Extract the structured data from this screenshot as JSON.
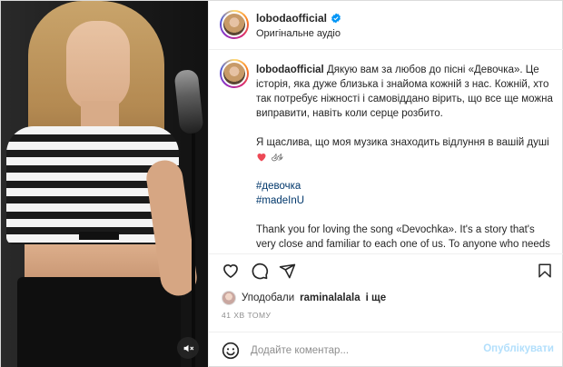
{
  "header": {
    "username": "lobodaofficial",
    "audio": "Оригінальне аудіо"
  },
  "caption": {
    "username": "lobodaofficial",
    "paragraph1": "Дякую вам за любов до пісні «Девочка». Це історія, яка дуже близька і знайома кожній з нас. Кожній, хто так потребує ніжності і самовіддано вірить, що все ще можна виправити, навіть коли серце розбито.",
    "paragraph2": "Я щаслива, що моя музика знаходить відлуння в вашій душі",
    "hashtags": [
      "#девочка",
      "#madeInU"
    ],
    "paragraph3": "Thank you for loving the song «Devochka». It's a story that's very close and familiar to each one of us. To anyone who needs tenderness and still believes that everything can be fixed, even when their heart is broken."
  },
  "likes": {
    "prefix": "Уподобали",
    "user": "raminalalala",
    "suffix": "і ще"
  },
  "time": "41 ХВ ТОМУ",
  "comment": {
    "placeholder": "Додайте коментар...",
    "publish": "Опублікувати"
  },
  "colors": {
    "verified": "#0095f6",
    "link": "#00376b",
    "publish_disabled": "#b2dffc",
    "heart": "#ed4956"
  },
  "icons": [
    "heart-icon",
    "comment-icon",
    "share-icon",
    "bookmark-icon",
    "emoji-icon",
    "sound-off-icon",
    "verified-icon",
    "red-heart-emoji",
    "white-doves-emoji"
  ]
}
